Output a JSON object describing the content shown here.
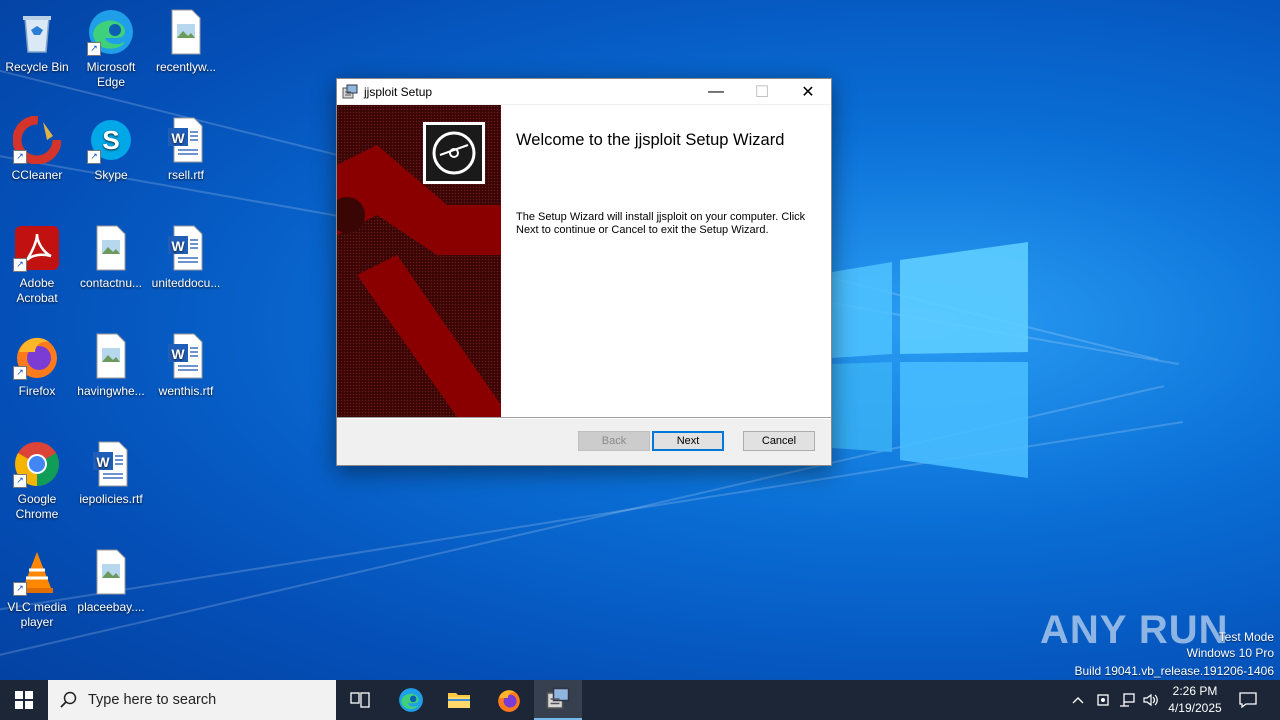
{
  "desktop": {
    "icons": [
      {
        "label": "Recycle Bin",
        "icon": "recycle-bin-icon"
      },
      {
        "label": "Microsoft Edge",
        "icon": "edge-icon"
      },
      {
        "label": "recentlyw...",
        "icon": "image-file-icon"
      },
      {
        "label": "CCleaner",
        "icon": "ccleaner-icon"
      },
      {
        "label": "Skype",
        "icon": "skype-icon"
      },
      {
        "label": "rsell.rtf",
        "icon": "word-doc-icon"
      },
      {
        "label": "Adobe Acrobat",
        "icon": "acrobat-icon"
      },
      {
        "label": "contactnu...",
        "icon": "image-file-icon"
      },
      {
        "label": "uniteddocu...",
        "icon": "word-doc-icon"
      },
      {
        "label": "Firefox",
        "icon": "firefox-icon"
      },
      {
        "label": "havingwhe...",
        "icon": "image-file-icon"
      },
      {
        "label": "wenthis.rtf",
        "icon": "word-doc-icon"
      },
      {
        "label": "Google Chrome",
        "icon": "chrome-icon"
      },
      {
        "label": "iepolicies.rtf",
        "icon": "word-doc-icon"
      },
      {
        "label": "VLC media player",
        "icon": "vlc-icon"
      },
      {
        "label": "placeebay....",
        "icon": "image-file-icon"
      }
    ]
  },
  "window": {
    "title": "jjsploit Setup",
    "heading": "Welcome to the jjsploit Setup Wizard",
    "body": "The Setup Wizard will install jjsploit on your computer. Click Next to continue or Cancel to exit the Setup Wizard.",
    "buttons": {
      "back": "Back",
      "next": "Next",
      "cancel": "Cancel"
    },
    "controls": {
      "minimize": "—",
      "maximize": "☐",
      "close": "✕"
    }
  },
  "watermark": {
    "logo": "ANY RUN",
    "line1": "Test Mode",
    "line2": "Windows 10 Pro",
    "line3": "Build 19041.vb_release.191206-1406"
  },
  "taskbar": {
    "search_placeholder": "Type here to search",
    "time": "2:26 PM",
    "date": "4/19/2025",
    "colors": {
      "background": "#1c2636",
      "accent": "#0078d7"
    }
  }
}
